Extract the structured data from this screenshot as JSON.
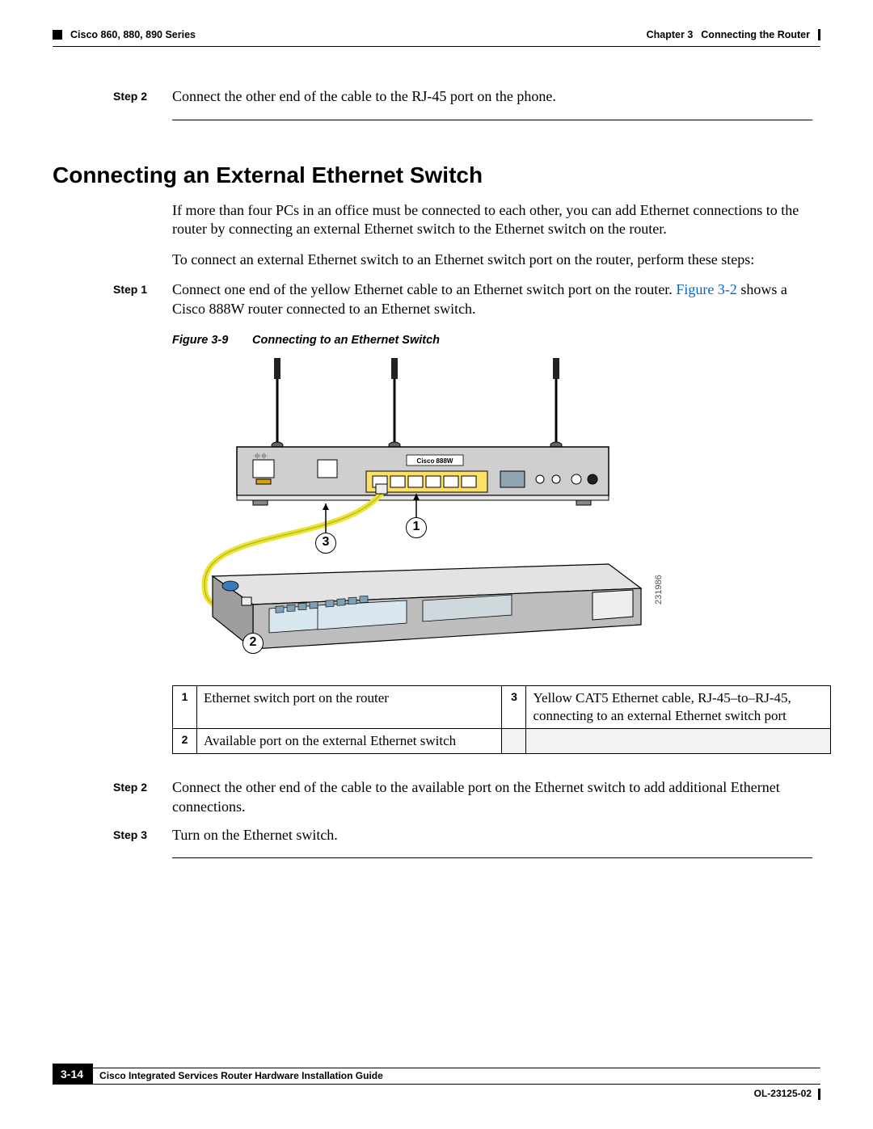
{
  "header": {
    "breadcrumb_left": "Cisco 860, 880, 890 Series",
    "chapter_label": "Chapter 3",
    "chapter_title": "Connecting the Router"
  },
  "pre_step": {
    "label": "Step 2",
    "text": "Connect the other end of the cable to the RJ-45 port on the phone."
  },
  "section_title": "Connecting an External Ethernet Switch",
  "intro_p1": "If more than four PCs in an office must be connected to each other, you can add Ethernet connections to the router by connecting an external Ethernet switch to the Ethernet switch on the router.",
  "intro_p2": "To connect an external Ethernet switch to an Ethernet switch port on the router, perform these steps:",
  "steps": {
    "s1": {
      "label": "Step 1",
      "text_a": "Connect one end of the yellow Ethernet cable to an Ethernet switch port on the router. ",
      "link": "Figure 3-2",
      "text_b": " shows a Cisco 888W router connected to an Ethernet switch."
    },
    "s2": {
      "label": "Step 2",
      "text": "Connect the other end of the cable to the available port on the Ethernet switch to add additional Ethernet connections."
    },
    "s3": {
      "label": "Step 3",
      "text": "Turn on the Ethernet switch."
    }
  },
  "figure": {
    "num": "Figure 3-9",
    "title": "Connecting to an Ethernet Switch",
    "callouts": {
      "c1": "1",
      "c2": "2",
      "c3": "3"
    },
    "image_id": "231986",
    "router_label": "Cisco 888W"
  },
  "legend": {
    "r1": {
      "n": "1",
      "d": "Ethernet switch port on the router"
    },
    "r2": {
      "n": "2",
      "d": "Available port on the external Ethernet switch"
    },
    "r3": {
      "n": "3",
      "d": "Yellow CAT5 Ethernet cable, RJ-45–to–RJ-45, connecting to an external Ethernet switch port"
    }
  },
  "footer": {
    "guide": "Cisco Integrated Services Router Hardware Installation Guide",
    "page": "3-14",
    "docid": "OL-23125-02"
  }
}
